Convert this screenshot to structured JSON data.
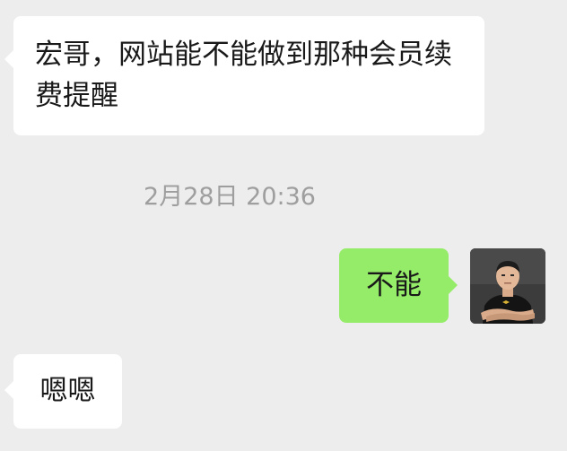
{
  "chat": {
    "messages": [
      {
        "side": "received",
        "text": "宏哥，网站能不能做到那种会员续费提醒"
      },
      {
        "side": "sent",
        "text": "不能"
      },
      {
        "side": "received",
        "text": "嗯嗯"
      }
    ],
    "timestamp": "2月28日 20:36"
  },
  "colors": {
    "background": "#ededed",
    "received_bubble": "#ffffff",
    "sent_bubble": "#95ec69",
    "timestamp_text": "#9e9e9e"
  },
  "icons": {
    "sender_avatar": "avatar-icon"
  }
}
